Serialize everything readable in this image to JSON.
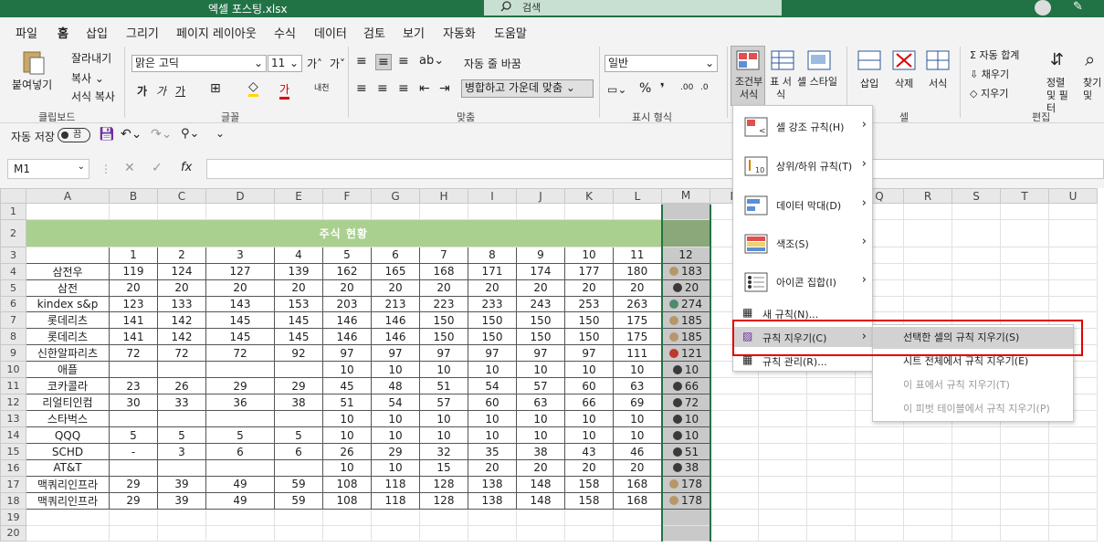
{
  "title": "엑셀 포스팅.xlsx",
  "search": {
    "label": "검색"
  },
  "menu": [
    "파일",
    "홈",
    "삽입",
    "그리기",
    "페이지 레이아웃",
    "수식",
    "데이터",
    "검토",
    "보기",
    "자동화",
    "도움말"
  ],
  "ribbon": {
    "paste": "붙여넣기",
    "cut": "잘라내기",
    "copy": "복사",
    "format_painter": "서식 복사",
    "clipboard": "클립보드",
    "font_name": "맑은 고딕",
    "font_size": "11",
    "font_group": "글꼴",
    "wrap": "자동 줄 바꿈",
    "merge": "병합하고 가운데 맞춤",
    "align_group": "맞춤",
    "number_format": "일반",
    "number_group": "표시 형식",
    "cond_format": "조건부 서식",
    "table_format": "표 서식",
    "cell_style": "셀 스타일",
    "insert": "삽입",
    "delete": "삭제",
    "format": "서식",
    "cells_group": "셀",
    "autosum": "자동 합계",
    "fill": "채우기",
    "clear": "지우기",
    "sort": "정렬 및 필터",
    "find": "찾기 및 선택",
    "edit_group": "편집"
  },
  "qat": {
    "autosave": "자동 저장",
    "toggle": "끔"
  },
  "namebox": "M1",
  "columns": [
    "A",
    "B",
    "C",
    "D",
    "E",
    "F",
    "G",
    "H",
    "I",
    "J",
    "K",
    "L",
    "M",
    "N",
    "O",
    "P",
    "Q",
    "R",
    "S",
    "T",
    "U"
  ],
  "sheet_title": "주식 현황",
  "header_row": [
    "1",
    "2",
    "3",
    "4",
    "5",
    "6",
    "7",
    "8",
    "9",
    "10",
    "11",
    "12"
  ],
  "rows": [
    {
      "name": "삼전우",
      "v": [
        "119",
        "124",
        "127",
        "139",
        "162",
        "165",
        "168",
        "171",
        "174",
        "177",
        "180",
        "183"
      ],
      "dot": "#b8966a"
    },
    {
      "name": "삼전",
      "v": [
        "20",
        "20",
        "20",
        "20",
        "20",
        "20",
        "20",
        "20",
        "20",
        "20",
        "20",
        "20"
      ],
      "dot": "#3a3a3a"
    },
    {
      "name": "kindex s&p",
      "v": [
        "123",
        "133",
        "143",
        "153",
        "203",
        "213",
        "223",
        "233",
        "243",
        "253",
        "263",
        "274"
      ],
      "dot": "#4e8a6f"
    },
    {
      "name": "롯데리츠",
      "v": [
        "141",
        "142",
        "145",
        "145",
        "146",
        "146",
        "150",
        "150",
        "150",
        "150",
        "175",
        "185"
      ],
      "dot": "#b8966a"
    },
    {
      "name": "롯데리츠",
      "v": [
        "141",
        "142",
        "145",
        "145",
        "146",
        "146",
        "150",
        "150",
        "150",
        "150",
        "175",
        "185"
      ],
      "dot": "#b8966a"
    },
    {
      "name": "신한알파리츠",
      "v": [
        "72",
        "72",
        "72",
        "92",
        "97",
        "97",
        "97",
        "97",
        "97",
        "97",
        "111",
        "121"
      ],
      "dot": "#c0392b"
    },
    {
      "name": "애플",
      "v": [
        "",
        "",
        "",
        "",
        "10",
        "10",
        "10",
        "10",
        "10",
        "10",
        "10",
        "10"
      ],
      "dot": "#3a3a3a"
    },
    {
      "name": "코카콜라",
      "v": [
        "23",
        "26",
        "29",
        "29",
        "45",
        "48",
        "51",
        "54",
        "57",
        "60",
        "63",
        "66"
      ],
      "dot": "#3a3a3a"
    },
    {
      "name": "리얼티인컴",
      "v": [
        "30",
        "33",
        "36",
        "38",
        "51",
        "54",
        "57",
        "60",
        "63",
        "66",
        "69",
        "72"
      ],
      "dot": "#3a3a3a"
    },
    {
      "name": "스타벅스",
      "v": [
        "",
        "",
        "",
        "",
        "10",
        "10",
        "10",
        "10",
        "10",
        "10",
        "10",
        "10"
      ],
      "dot": "#3a3a3a"
    },
    {
      "name": "QQQ",
      "v": [
        "5",
        "5",
        "5",
        "5",
        "10",
        "10",
        "10",
        "10",
        "10",
        "10",
        "10",
        "10"
      ],
      "dot": "#3a3a3a"
    },
    {
      "name": "SCHD",
      "v": [
        "-",
        "3",
        "6",
        "6",
        "26",
        "29",
        "32",
        "35",
        "38",
        "43",
        "46",
        "51"
      ],
      "dot": "#3a3a3a"
    },
    {
      "name": "AT&T",
      "v": [
        "",
        "",
        "",
        "",
        "10",
        "10",
        "15",
        "20",
        "20",
        "20",
        "20",
        "38"
      ],
      "dot": "#3a3a3a"
    },
    {
      "name": "맥쿼리인프라",
      "v": [
        "29",
        "39",
        "49",
        "59",
        "108",
        "118",
        "128",
        "138",
        "148",
        "158",
        "168",
        "178"
      ],
      "dot": "#b8966a"
    },
    {
      "name": "맥쿼리인프라",
      "v": [
        "29",
        "39",
        "49",
        "59",
        "108",
        "118",
        "128",
        "138",
        "148",
        "158",
        "168",
        "178"
      ],
      "dot": "#b8966a"
    }
  ],
  "cf_menu": [
    {
      "label": "셀 강조 규칙(H)"
    },
    {
      "label": "상위/하위 규칙(T)"
    },
    {
      "label": "데이터 막대(D)"
    },
    {
      "label": "색조(S)"
    },
    {
      "label": "아이콘 집합(I)"
    }
  ],
  "cf_small": [
    "새 규칙(N)...",
    "규칙 지우기(C)",
    "규칙 관리(R)..."
  ],
  "submenu": [
    "선택한 셀의 규칙 지우기(S)",
    "시트 전체에서 규칙 지우기(E)",
    "이 표에서 규칙 지우기(T)",
    "이 피벗 테이블에서 규칙 지우기(P)"
  ]
}
